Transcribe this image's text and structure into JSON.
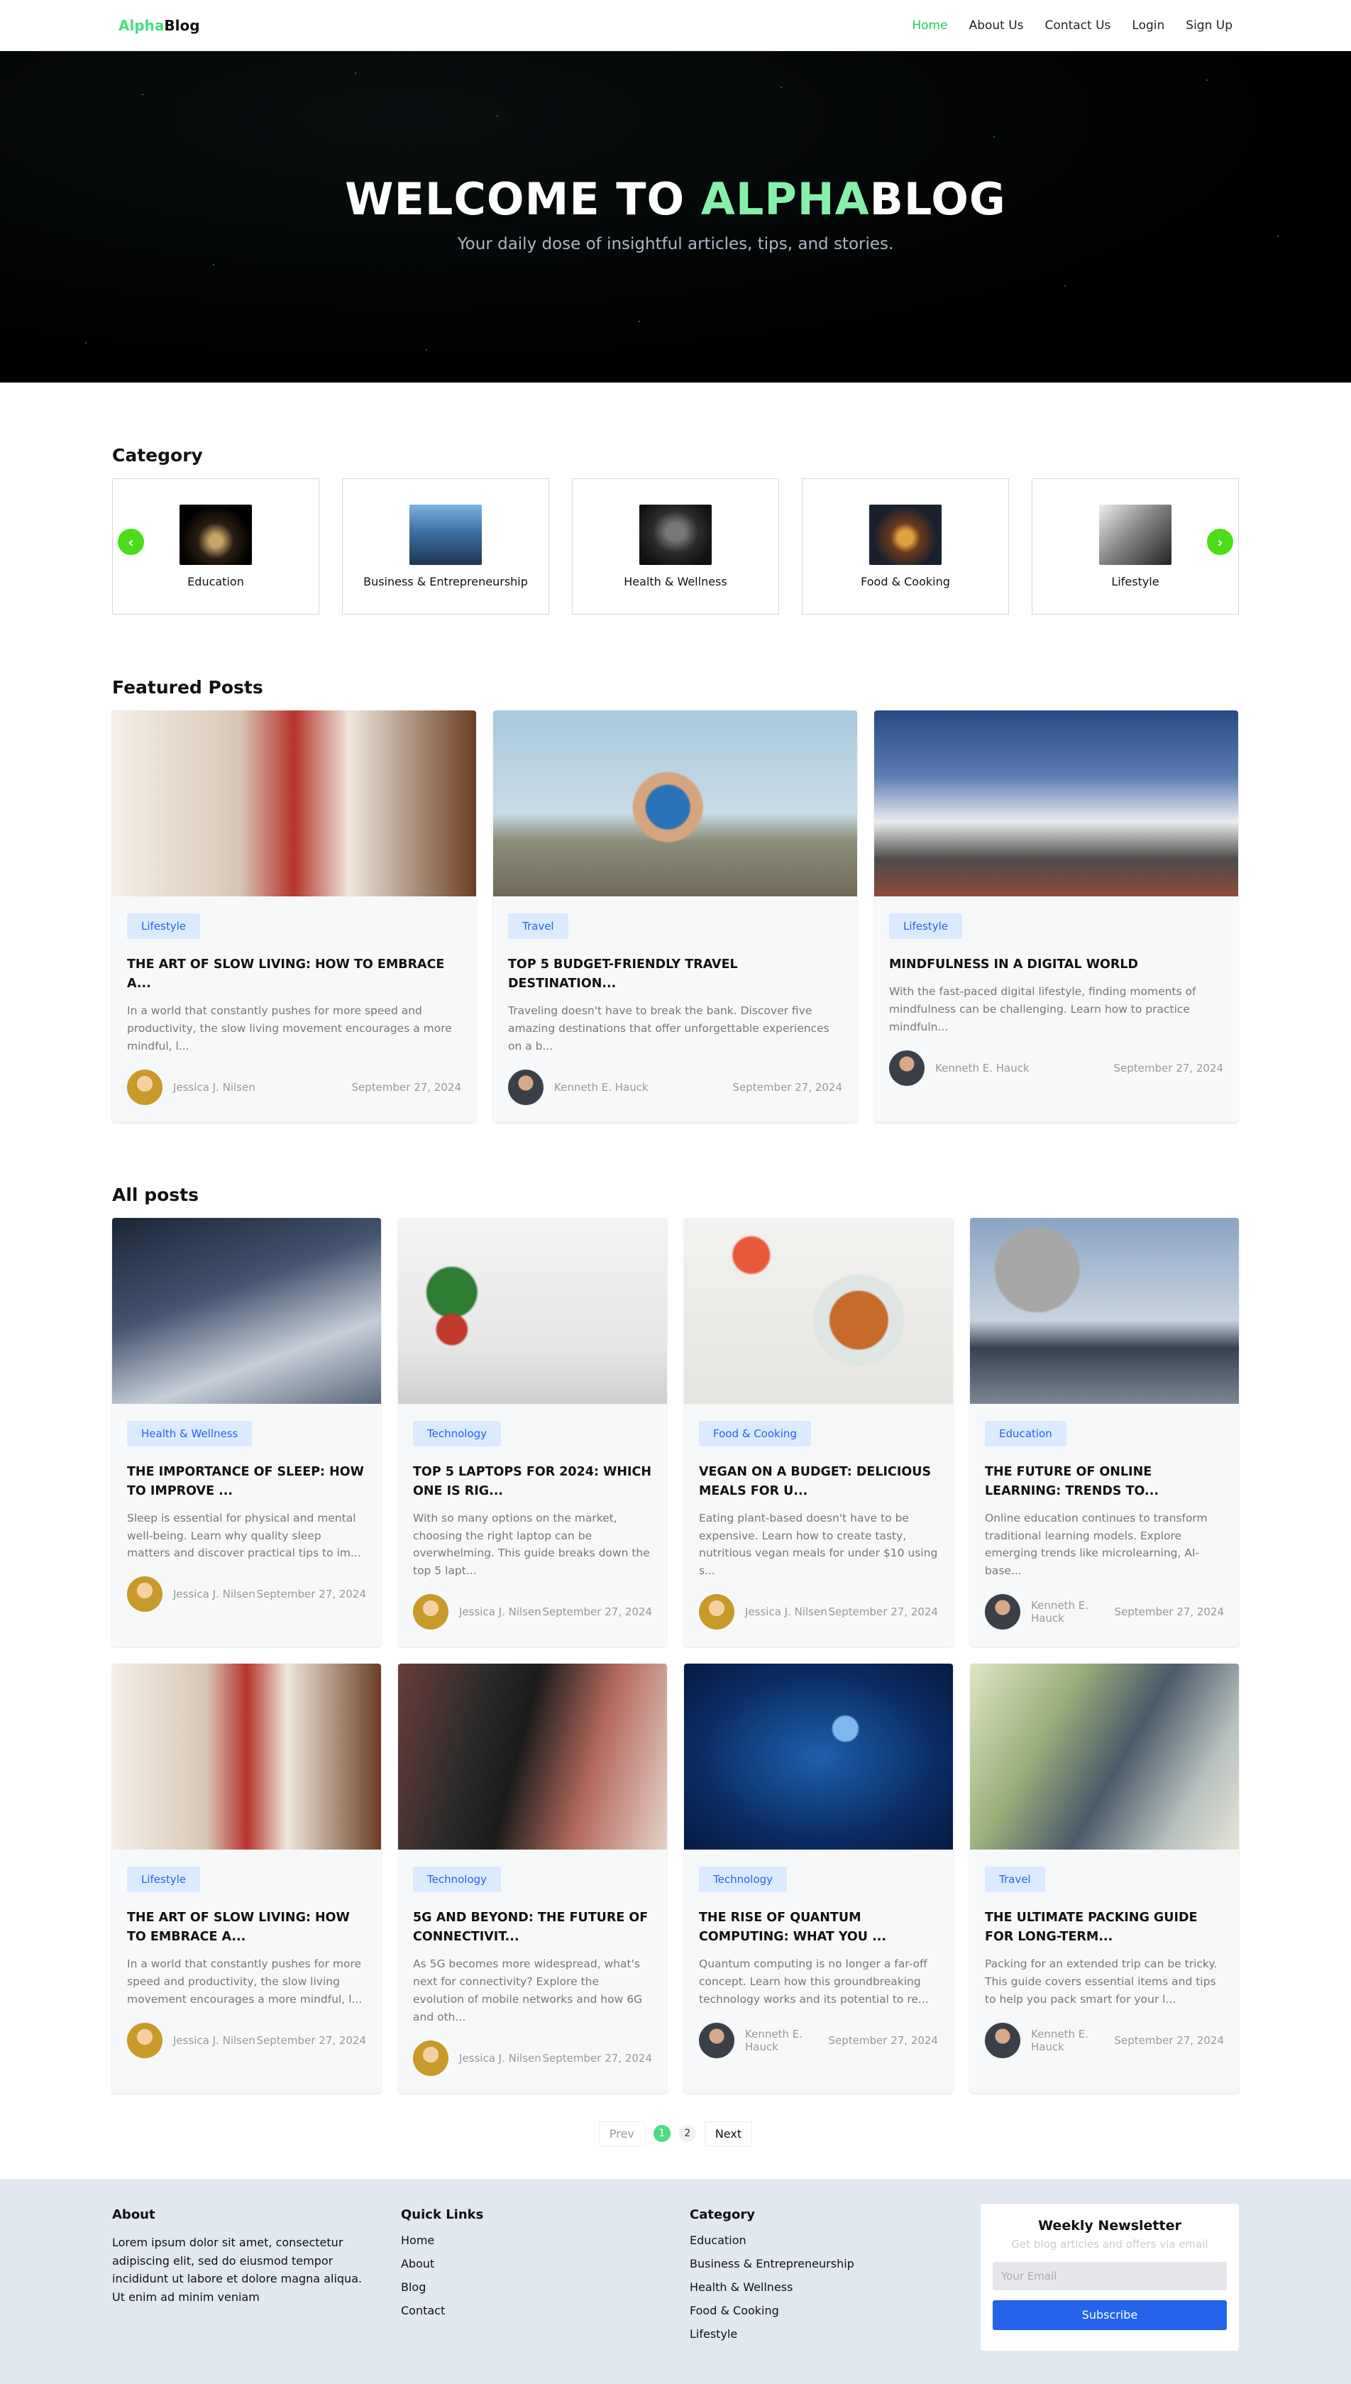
{
  "nav": {
    "logo_a": "Alpha",
    "logo_b": "Blog",
    "links": [
      "Home",
      "About Us",
      "Contact Us",
      "Login",
      "Sign Up"
    ]
  },
  "hero": {
    "title_a": "WELCOME TO ",
    "title_b": "ALPHA",
    "title_c": "BLOG",
    "subtitle": "Your daily dose of insightful articles, tips, and stories."
  },
  "category": {
    "title": "Category",
    "items": [
      "Education",
      "Business & Entrepreneurship",
      "Health & Wellness",
      "Food & Cooking",
      "Lifestyle"
    ]
  },
  "featured": {
    "title": "Featured Posts",
    "posts": [
      {
        "tag": "Lifestyle",
        "title": "THE ART OF SLOW LIVING: HOW TO EMBRACE A...",
        "excerpt": "In a world that constantly pushes for more speed and productivity, the slow living movement encourages a more mindful, l...",
        "author": "Jessica J. Nilsen",
        "date": "September 27, 2024"
      },
      {
        "tag": "Travel",
        "title": "TOP 5 BUDGET-FRIENDLY TRAVEL DESTINATION...",
        "excerpt": "Traveling doesn't have to break the bank. Discover five amazing destinations that offer unforgettable experiences on a b...",
        "author": "Kenneth E. Hauck",
        "date": "September 27, 2024"
      },
      {
        "tag": "Lifestyle",
        "title": "MINDFULNESS IN A DIGITAL WORLD",
        "excerpt": "With the fast-paced digital lifestyle, finding moments of mindfulness can be challenging. Learn how to practice mindfuln...",
        "author": "Kenneth E. Hauck",
        "date": "September 27, 2024"
      }
    ]
  },
  "allposts": {
    "title": "All posts",
    "posts": [
      {
        "tag": "Health & Wellness",
        "title": "THE IMPORTANCE OF SLEEP: HOW TO IMPROVE ...",
        "excerpt": "Sleep is essential for physical and mental well-being. Learn why quality sleep matters and discover practical tips to im...",
        "author": "Jessica J. Nilsen",
        "date": "September 27, 2024"
      },
      {
        "tag": "Technology",
        "title": "TOP 5 LAPTOPS FOR 2024: WHICH ONE IS RIG...",
        "excerpt": "With so many options on the market, choosing the right laptop can be overwhelming. This guide breaks down the top 5 lapt...",
        "author": "Jessica J. Nilsen",
        "date": "September 27, 2024"
      },
      {
        "tag": "Food & Cooking",
        "title": "VEGAN ON A BUDGET: DELICIOUS MEALS FOR U...",
        "excerpt": "Eating plant-based doesn't have to be expensive. Learn how to create tasty, nutritious vegan meals for under $10 using s...",
        "author": "Jessica J. Nilsen",
        "date": "September 27, 2024"
      },
      {
        "tag": "Education",
        "title": "THE FUTURE OF ONLINE LEARNING: TRENDS TO...",
        "excerpt": "Online education continues to transform traditional learning models. Explore emerging trends like microlearning, AI-base...",
        "author": "Kenneth E. Hauck",
        "date": "September 27, 2024"
      },
      {
        "tag": "Lifestyle",
        "title": "THE ART OF SLOW LIVING: HOW TO EMBRACE A...",
        "excerpt": "In a world that constantly pushes for more speed and productivity, the slow living movement encourages a more mindful, l...",
        "author": "Jessica J. Nilsen",
        "date": "September 27, 2024"
      },
      {
        "tag": "Technology",
        "title": "5G AND BEYOND: THE FUTURE OF CONNECTIVIT...",
        "excerpt": "As 5G becomes more widespread, what's next for connectivity? Explore the evolution of mobile networks and how 6G and oth...",
        "author": "Jessica J. Nilsen",
        "date": "September 27, 2024"
      },
      {
        "tag": "Technology",
        "title": "THE RISE OF QUANTUM COMPUTING: WHAT YOU ...",
        "excerpt": "Quantum computing is no longer a far-off concept. Learn how this groundbreaking technology works and its potential to re...",
        "author": "Kenneth E. Hauck",
        "date": "September 27, 2024"
      },
      {
        "tag": "Travel",
        "title": "THE ULTIMATE PACKING GUIDE FOR LONG-TERM...",
        "excerpt": "Packing for an extended trip can be tricky. This guide covers essential items and tips to help you pack smart for your l...",
        "author": "Kenneth E. Hauck",
        "date": "September 27, 2024"
      }
    ]
  },
  "pagination": {
    "prev": "Prev",
    "pages": [
      "1",
      "2"
    ],
    "next": "Next"
  },
  "footer": {
    "about_title": "About",
    "about_text": "Lorem ipsum dolor sit amet, consectetur adipiscing elit, sed do eiusmod tempor incididunt ut labore et dolore magna aliqua. Ut enim ad minim veniam",
    "links_title": "Quick Links",
    "links": [
      "Home",
      "About",
      "Blog",
      "Contact"
    ],
    "cat_title": "Category",
    "cats": [
      "Education",
      "Business & Entrepreneurship",
      "Health & Wellness",
      "Food & Cooking",
      "Lifestyle"
    ],
    "newsletter": {
      "title": "Weekly Newsletter",
      "subtitle": "Get blog articles and offers via email",
      "placeholder": "Your Email",
      "button": "Subscribe"
    }
  },
  "colors": {
    "accent": "#4ade80",
    "tag_bg": "#dbeafe",
    "tag_text": "#2563eb",
    "button": "#2563eb",
    "footer_bg": "#e2e8f0"
  }
}
